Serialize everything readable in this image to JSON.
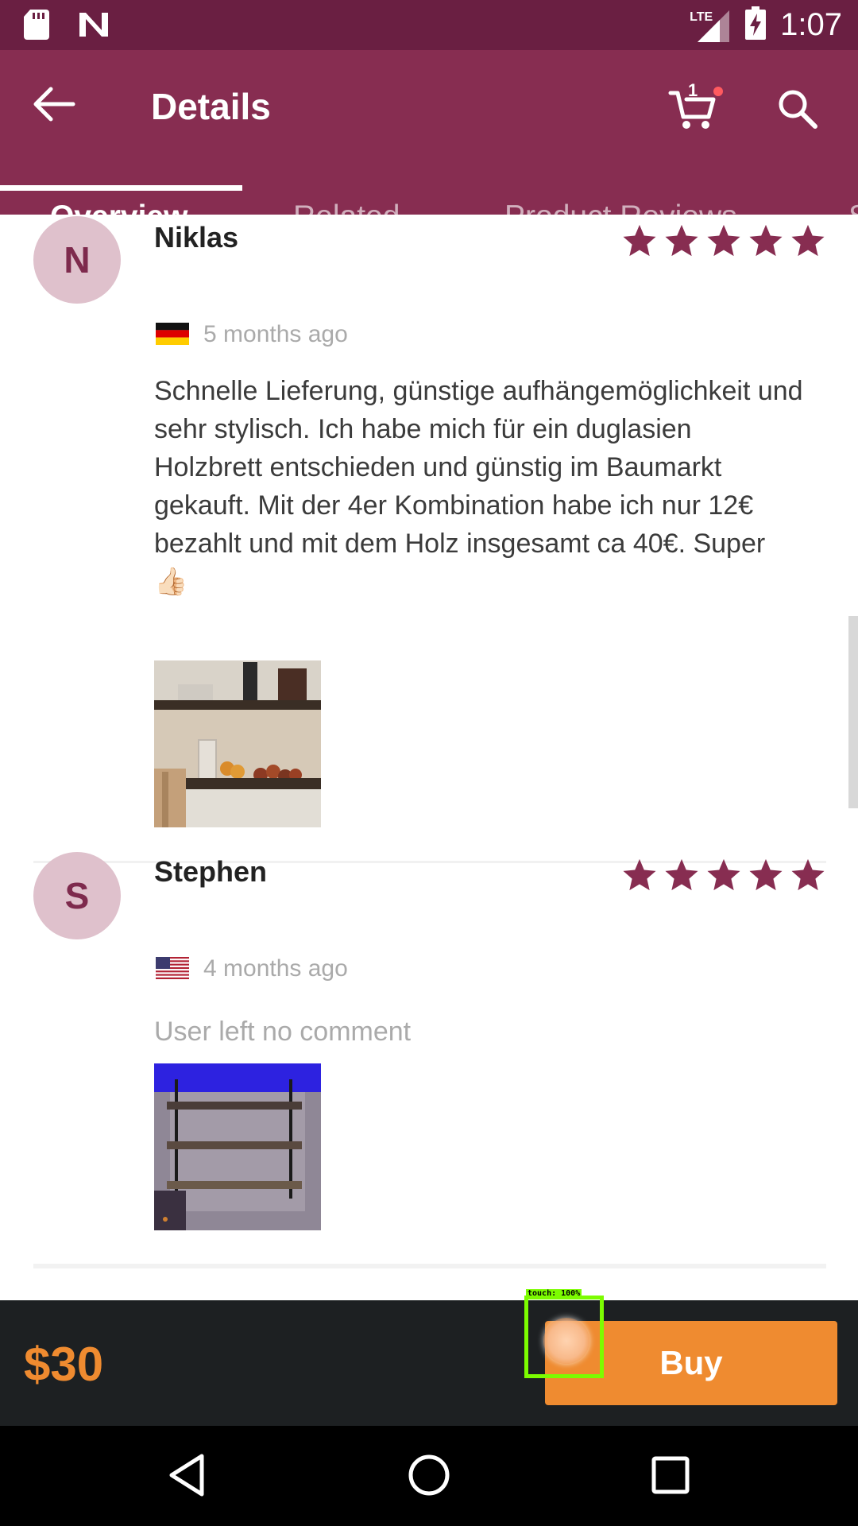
{
  "status_bar": {
    "time": "1:07",
    "network": "LTE",
    "icons": [
      "sd-card-icon",
      "n-notification-icon",
      "lte-signal-icon",
      "battery-charging-icon"
    ]
  },
  "app_bar": {
    "title": "Details",
    "cart_count": "1",
    "icons": [
      "back-arrow-icon",
      "cart-icon",
      "search-icon"
    ]
  },
  "tabs": [
    {
      "label": "Overview",
      "active": true
    },
    {
      "label": "Related",
      "active": false
    },
    {
      "label": "Product Reviews",
      "active": false
    },
    {
      "label": "S",
      "active": false
    }
  ],
  "reviews": [
    {
      "initial": "N",
      "name": "Niklas",
      "flag": "germany-flag",
      "time_ago": "5 months ago",
      "rating": 5,
      "text": "Schnelle Lieferung, günstige aufhängemöglichkeit und sehr stylisch. Ich habe mich für ein duglasien Holzbrett entschieden und günstig im Baumarkt gekauft. Mit der 4er Kombination habe ich nur 12€ bezahlt und mit dem Holz insgesamt ca 40€. Super 👍🏻"
    },
    {
      "initial": "S",
      "name": "Stephen",
      "flag": "usa-flag",
      "time_ago": "4 months ago",
      "rating": 5,
      "text": "User left no comment"
    }
  ],
  "buy_bar": {
    "price": "$30",
    "buy_label": "Buy"
  },
  "touch_indicator": {
    "label": "touch: 100%"
  },
  "colors": {
    "status_bar": "#6a1f42",
    "app_bar": "#872d51",
    "star": "#872d51",
    "accent_orange": "#ef8b30",
    "buy_bar_bg": "#1d2022"
  }
}
